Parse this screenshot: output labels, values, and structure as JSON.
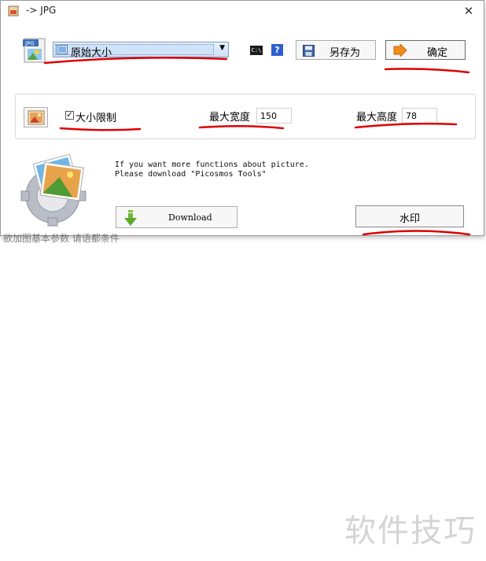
{
  "window": {
    "title": "-> JPG",
    "close_glyph": "✕"
  },
  "toolbar": {
    "size_select": {
      "selected": "原始大小"
    },
    "cmd_icon_text": "C:\\",
    "help_icon_text": "?",
    "saveas_label": "另存为",
    "ok_label": "确定"
  },
  "limit": {
    "checkbox_checked": true,
    "checkbox_mark": "✓",
    "checkbox_label": "大小限制",
    "max_width_label": "最大宽度",
    "max_width_value": "150",
    "max_height_label": "最大高度",
    "max_height_value": "78"
  },
  "promo": {
    "text": "If you want more functions about picture.\nPlease download \"Picosmos Tools\"",
    "download_label": "Download",
    "watermark_label": "水印"
  },
  "background": {
    "cut_text": "欲加图基本参数 请语都条件",
    "site_mark": "软件技巧"
  },
  "colors": {
    "annotation": "#dd0000",
    "accent": "#2e5fd0",
    "ok_arrow": "#f08c1a"
  }
}
